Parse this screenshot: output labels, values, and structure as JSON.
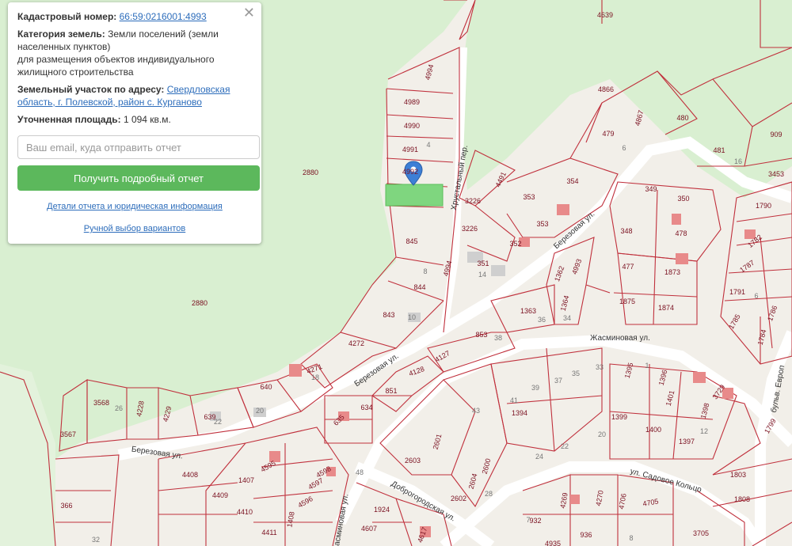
{
  "info": {
    "cadastral_label": "Кадастровый номер:",
    "cadastral_value": "66:59:0216001:4993",
    "category_label": "Категория земель:",
    "category_value_1": "Земли поселений (земли населенных пунктов)",
    "category_value_2": "для размещения объектов индивидуального жилищного строительства",
    "address_label": "Земельный участок по адресу:",
    "address_value": "Свердловская область, г. Полевской, район с. Курганово",
    "area_label": "Уточненная площадь:",
    "area_value": "1 094 кв.м.",
    "email_placeholder": "Ваш email, куда отправить отчет",
    "report_button": "Получить подробный отчет",
    "details_link": "Детали отчета и юридическая информация",
    "manual_link": "Ручной выбор вариантов",
    "close": "✕"
  },
  "colors": {
    "forest": "#d9efd1",
    "land": "#f2efe9",
    "parcel_line": "#c0303c",
    "selected": "#7fd67f",
    "marker": "#3d7fd6",
    "button": "#5cb85c",
    "link": "#2d6dbb"
  },
  "map": {
    "parcel_labels": [
      "4639",
      "4994",
      "4989",
      "4990",
      "4991",
      "4992",
      "4866",
      "4867",
      "480",
      "909",
      "479",
      "481",
      "3453",
      "4491",
      "3226",
      "353",
      "354",
      "349",
      "350",
      "1790",
      "845",
      "3226",
      "352",
      "348",
      "478",
      "1782",
      "4994",
      "351",
      "353",
      "1362",
      "4993",
      "477",
      "1873",
      "1787",
      "844",
      "1875",
      "1874",
      "1791",
      "1786",
      "843",
      "1363",
      "1364",
      "1785",
      "1784",
      "4272",
      "853",
      "1395",
      "1396",
      "4271",
      "4127",
      "4128",
      "851",
      "1401",
      "3729",
      "640",
      "634",
      "1398",
      "1799",
      "3568",
      "4228",
      "4229",
      "639",
      "635",
      "1394",
      "1399",
      "1400",
      "3567",
      "2601",
      "1397",
      "4595",
      "4598",
      "2603",
      "2600",
      "1803",
      "4408",
      "4597",
      "2604",
      "1407",
      "4596",
      "2602",
      "4706",
      "4705",
      "4269",
      "4270",
      "1808",
      "4409",
      "4410",
      "1408",
      "1924",
      "932",
      "936",
      "3705",
      "366",
      "4411",
      "4607",
      "4617",
      "4935",
      "2880",
      "2880"
    ],
    "house_numbers": [
      "4",
      "6",
      "8",
      "16",
      "14",
      "10",
      "36",
      "34",
      "38",
      "35",
      "33",
      "37",
      "41",
      "39",
      "43",
      "26",
      "22",
      "20",
      "20",
      "22",
      "18",
      "24",
      "28",
      "48",
      "12",
      "7",
      "8",
      "32",
      "6",
      "1"
    ],
    "streets": [
      "Березовая ул.",
      "Березовая ул.",
      "Березовая ул.",
      "Жасминовая ул.",
      "Хрустальный пер.",
      "ул. Садовое Кольцо",
      "Доброгородская ул.",
      "Жасминовая ул.",
      "бульв. Европ"
    ]
  }
}
